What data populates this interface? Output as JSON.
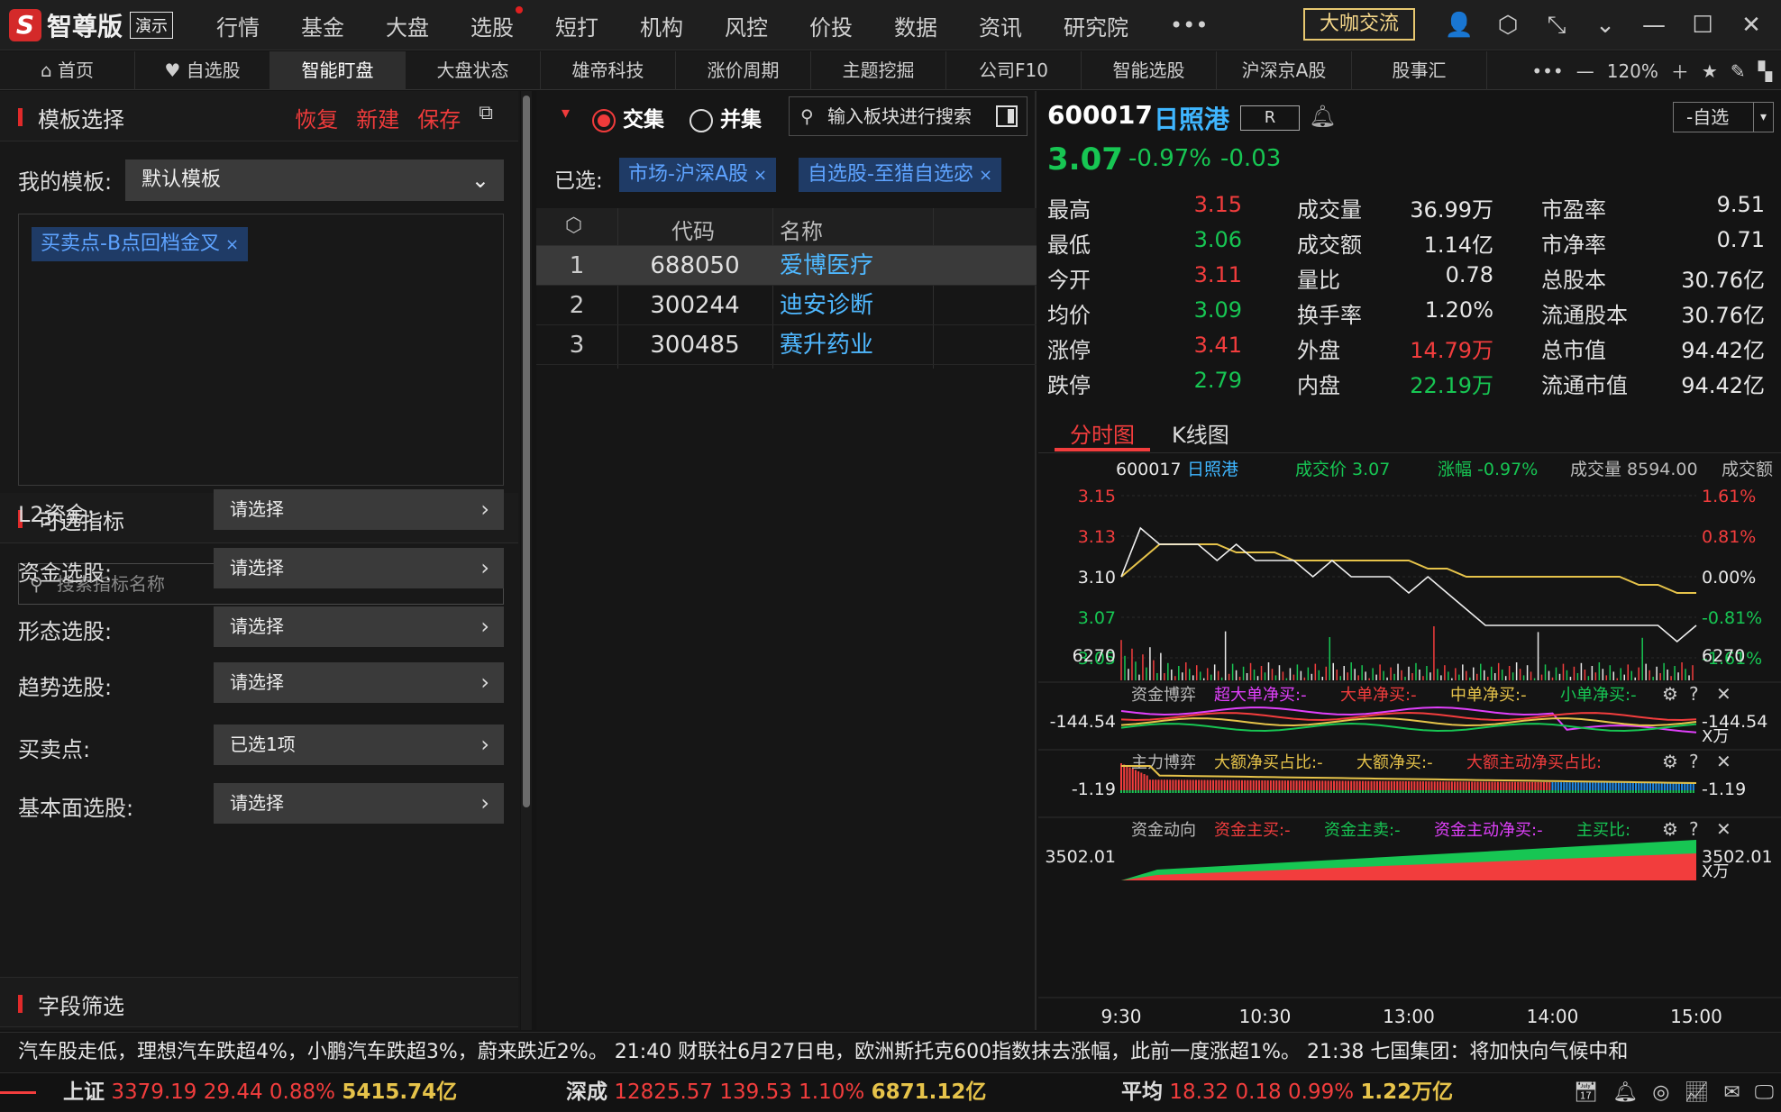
{
  "app": {
    "logo_char": "S",
    "name": "智尊版",
    "badge": "演示"
  },
  "topnav": [
    "行情",
    "基金",
    "大盘",
    "选股",
    "短打",
    "机构",
    "风控",
    "价投",
    "数据",
    "资讯",
    "研究院"
  ],
  "topbar": {
    "more": "•••",
    "exchange_label": "大咖交流"
  },
  "tabs": [
    "首页",
    "自选股",
    "智能盯盘",
    "大盘状态",
    "雄帝科技",
    "涨价周期",
    "主题挖掘",
    "公司F10",
    "智能选股",
    "沪深京A股",
    "股事汇"
  ],
  "tab_tools": {
    "more": "•••",
    "zoom": "120%"
  },
  "left": {
    "template_title": "模板选择",
    "actions": [
      "恢复",
      "新建",
      "保存"
    ],
    "my_template_label": "我的模板:",
    "my_template_value": "默认模板",
    "template_tag": "买卖点-B点回档金叉",
    "indicators_title": "可选指标",
    "search_placeholder": "搜索指标名称",
    "filters": [
      {
        "label": "L2资金:",
        "value": "请选择"
      },
      {
        "label": "资金选股:",
        "value": "请选择"
      },
      {
        "label": "形态选股:",
        "value": "请选择"
      },
      {
        "label": "趋势选股:",
        "value": "请选择"
      },
      {
        "label": "买卖点:",
        "value": "已选1项"
      },
      {
        "label": "基本面选股:",
        "value": "请选择"
      }
    ],
    "field_filter_title": "字段筛选"
  },
  "mid": {
    "intersect": "交集",
    "union": "并集",
    "search_placeholder": "输入板块进行搜索",
    "selected_label": "已选:",
    "selected_tags": [
      "市场-沪深A股",
      "自选股-至猎自选宓"
    ],
    "col_code": "代码",
    "col_name": "名称",
    "rows": [
      {
        "n": "1",
        "code": "688050",
        "name": "爱博医疗"
      },
      {
        "n": "2",
        "code": "300244",
        "name": "迪安诊断"
      },
      {
        "n": "3",
        "code": "300485",
        "name": "赛升药业"
      }
    ]
  },
  "stock": {
    "code": "600017",
    "name": "日照港",
    "r_badge": "R",
    "watch_btn": "-自选",
    "price": "3.07",
    "pct": "-0.97%",
    "change": "-0.03",
    "quote": [
      {
        "l": "最高",
        "v": "3.15",
        "c": "red"
      },
      {
        "l": "成交量",
        "v": "36.99万",
        "c": ""
      },
      {
        "l": "市盈率",
        "v": "9.51",
        "c": ""
      },
      {
        "l": "最低",
        "v": "3.06",
        "c": "green"
      },
      {
        "l": "成交额",
        "v": "1.14亿",
        "c": ""
      },
      {
        "l": "市净率",
        "v": "0.71",
        "c": ""
      },
      {
        "l": "今开",
        "v": "3.11",
        "c": "red"
      },
      {
        "l": "量比",
        "v": "0.78",
        "c": ""
      },
      {
        "l": "总股本",
        "v": "30.76亿",
        "c": ""
      },
      {
        "l": "均价",
        "v": "3.09",
        "c": "green"
      },
      {
        "l": "换手率",
        "v": "1.20%",
        "c": ""
      },
      {
        "l": "流通股本",
        "v": "30.76亿",
        "c": ""
      },
      {
        "l": "涨停",
        "v": "3.41",
        "c": "red"
      },
      {
        "l": "外盘",
        "v": "14.79万",
        "c": "red"
      },
      {
        "l": "总市值",
        "v": "94.42亿",
        "c": ""
      },
      {
        "l": "跌停",
        "v": "2.79",
        "c": "green"
      },
      {
        "l": "内盘",
        "v": "22.19万",
        "c": "green"
      },
      {
        "l": "流通市值",
        "v": "94.42亿",
        "c": ""
      }
    ],
    "chart_tabs": [
      "分时图",
      "K线图"
    ]
  },
  "chart_data": {
    "type": "line",
    "header": {
      "code": "600017",
      "name": "日照港",
      "price_label": "成交价 3.07",
      "pct_label": "涨幅 -0.97%",
      "vol_label": "成交量 8594.00",
      "extra": "成交额"
    },
    "y_left": [
      "3.15",
      "3.13",
      "3.10",
      "3.07",
      "3.05"
    ],
    "y_right": [
      "1.61%",
      "0.81%",
      "0.00%",
      "-0.81%",
      "-1.61%"
    ],
    "ylim": [
      3.05,
      3.15
    ],
    "volume_label": "6270",
    "x_ticks": [
      "9:30",
      "10:30",
      "13:00",
      "14:00",
      "15:00"
    ],
    "price_series": [
      3.1,
      3.13,
      3.12,
      3.12,
      3.12,
      3.11,
      3.12,
      3.11,
      3.11,
      3.11,
      3.1,
      3.11,
      3.1,
      3.1,
      3.1,
      3.09,
      3.1,
      3.09,
      3.08,
      3.07,
      3.07,
      3.07,
      3.07,
      3.07,
      3.07,
      3.07,
      3.07,
      3.07,
      3.07,
      3.06,
      3.07
    ],
    "avg_series": [
      3.1,
      3.11,
      3.12,
      3.12,
      3.12,
      3.12,
      3.115,
      3.115,
      3.115,
      3.11,
      3.11,
      3.11,
      3.11,
      3.11,
      3.11,
      3.11,
      3.105,
      3.105,
      3.1,
      3.1,
      3.1,
      3.1,
      3.1,
      3.1,
      3.1,
      3.1,
      3.1,
      3.095,
      3.095,
      3.09,
      3.09
    ],
    "panels": [
      {
        "title": "资金博弈",
        "labels": [
          "超大单净买:-",
          "大单净买:-",
          "中单净买:-",
          "小单净买:-"
        ],
        "label_colors": [
          "#e040fb",
          "#f23d3d",
          "#e6c34a",
          "#17c653"
        ],
        "left": "-144.54",
        "right": "-144.54",
        "unit": "万"
      },
      {
        "title": "主力博弈",
        "labels": [
          "大额净买占比:-",
          "大额净买:-",
          "大额主动净买占比:"
        ],
        "label_colors": [
          "#e6c34a",
          "#e6c34a",
          "#f23d3d"
        ],
        "left": "-1.19",
        "right": "-1.19",
        "unit": ""
      },
      {
        "title": "资金动向",
        "labels": [
          "资金主买:-",
          "资金主卖:-",
          "资金主动净买:-",
          "主买比:"
        ],
        "label_colors": [
          "#f23d3d",
          "#17c653",
          "#e040fb",
          "#17c653"
        ],
        "left": "3502.01",
        "right": "3502.01",
        "unit": "万"
      }
    ]
  },
  "ticker": "汽车股走低，理想汽车跌超4%，小鹏汽车跌超3%，蔚来跌近2%。      21:40 财联社6月27日电，欧洲斯托克600指数抹去涨幅，此前一度涨超1%。      21:38 七国集团：将加快向气候中和",
  "indices": [
    {
      "name": "上证",
      "val": "3379.19",
      "chg": "29.44",
      "pct": "0.88%",
      "amt": "5415.74亿"
    },
    {
      "name": "深成",
      "val": "12825.57",
      "chg": "139.53",
      "pct": "1.10%",
      "amt": "6871.12亿"
    },
    {
      "name": "平均",
      "val": "18.32",
      "chg": "0.18",
      "pct": "0.99%",
      "amt": "1.22万亿"
    }
  ]
}
